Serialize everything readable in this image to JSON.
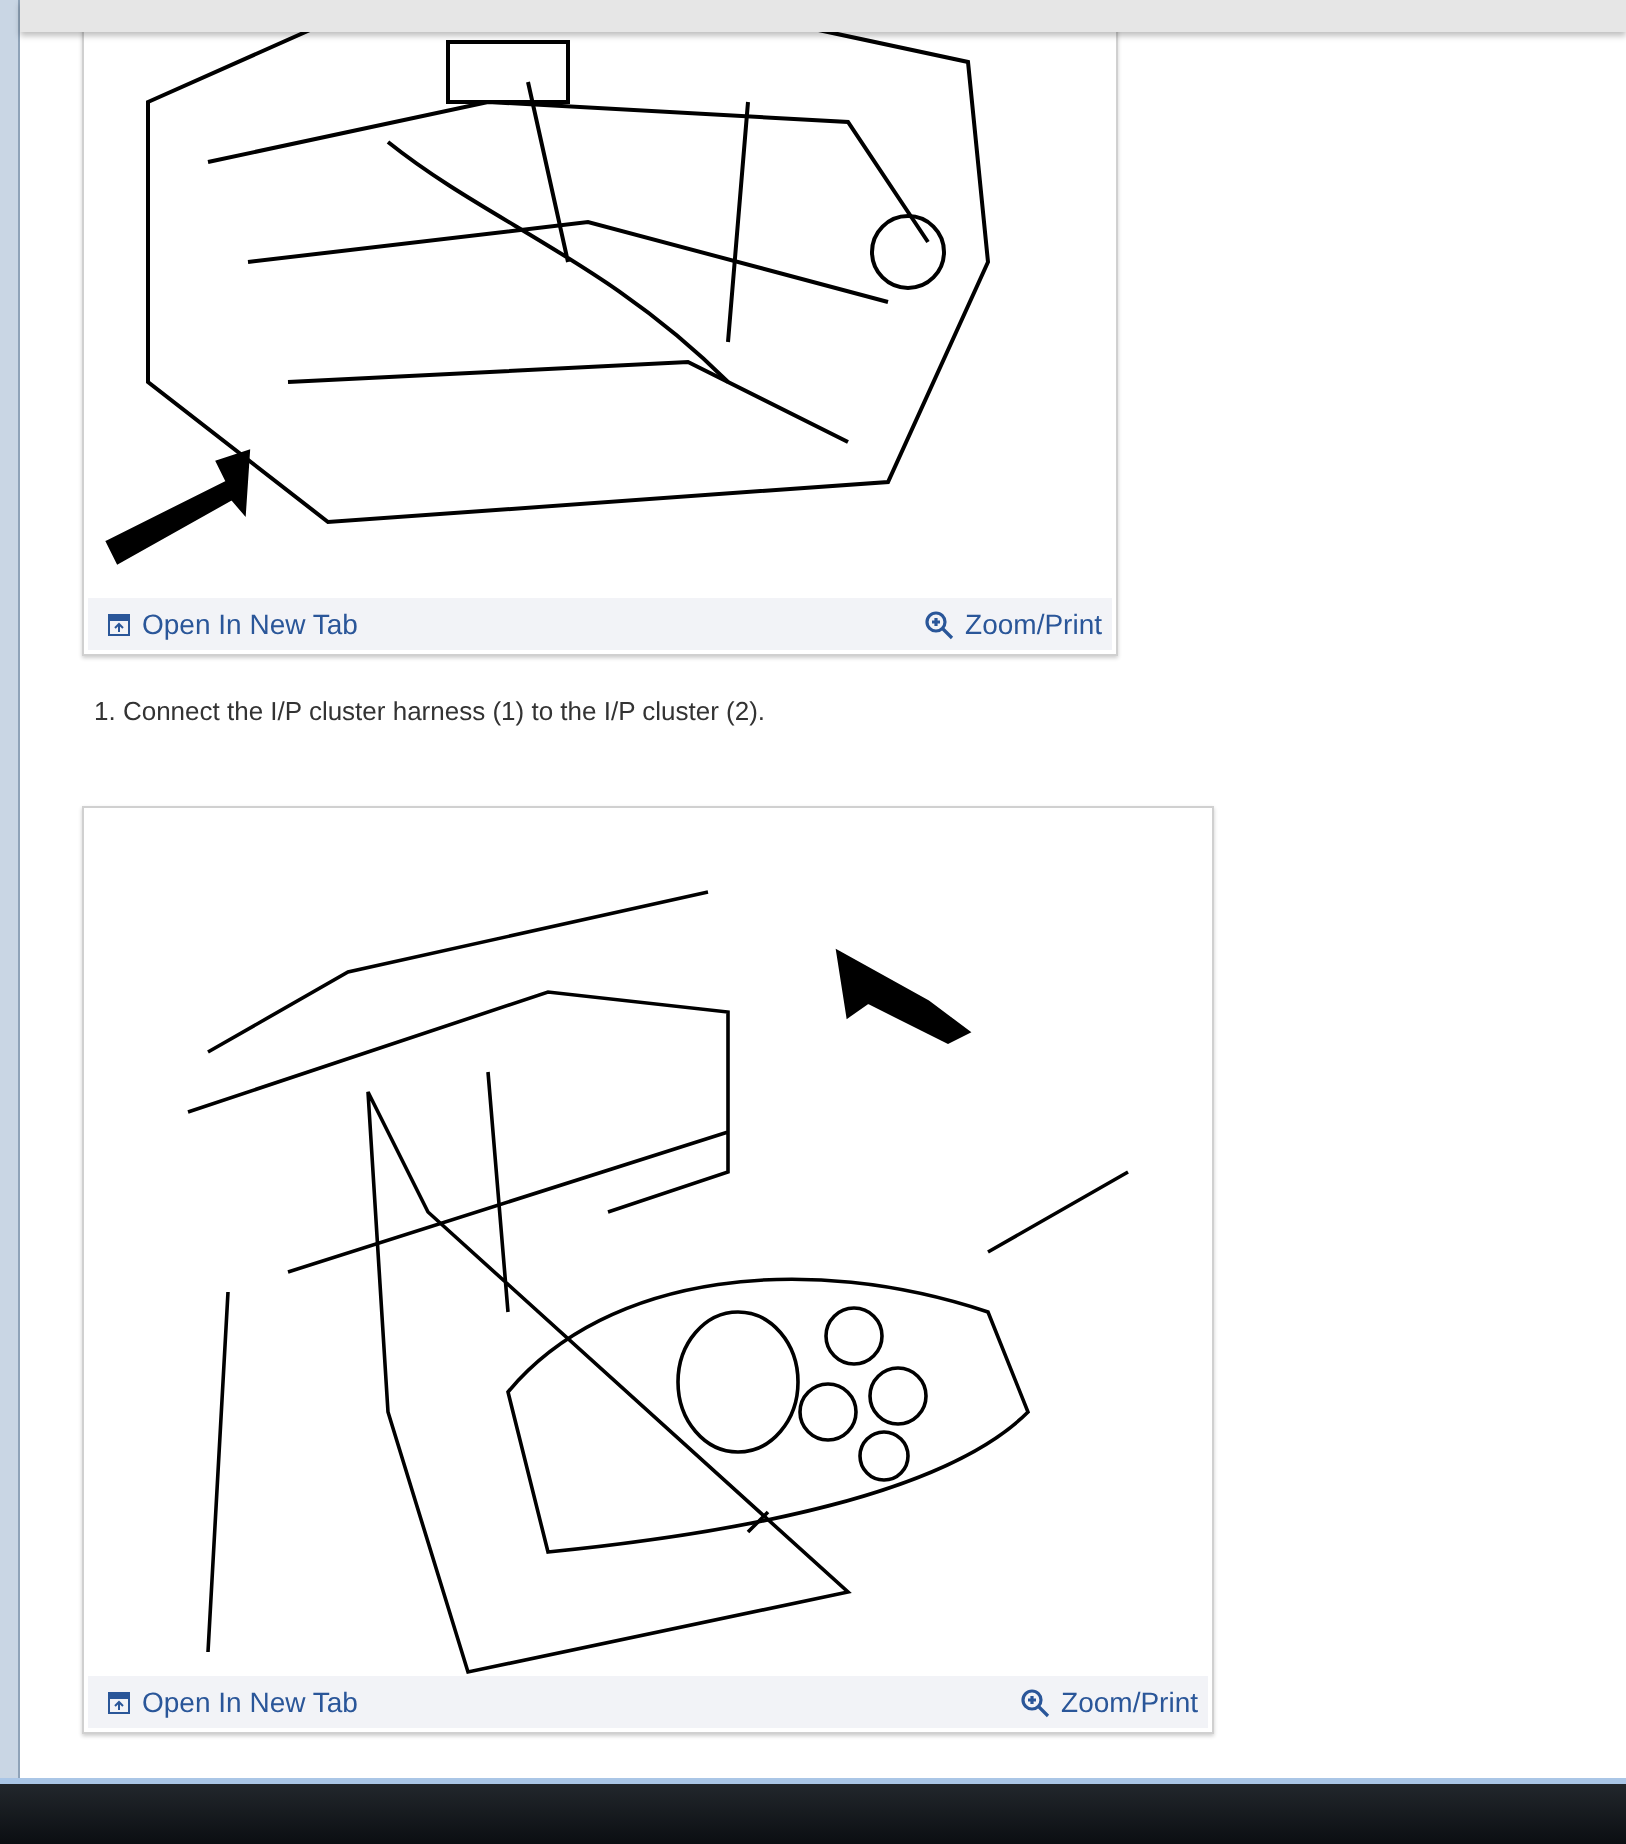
{
  "figures": [
    {
      "open_link": "Open In New Tab",
      "zoom_link": "Zoom/Print",
      "kind": "harness"
    },
    {
      "open_link": "Open In New Tab",
      "zoom_link": "Zoom/Print",
      "kind": "cluster"
    }
  ],
  "steps": [
    "1. Connect the I/P cluster harness (1) to the I/P cluster (2)."
  ]
}
